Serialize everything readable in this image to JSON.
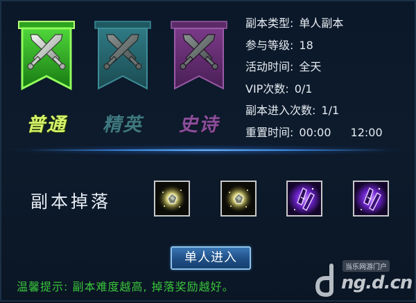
{
  "tiers": [
    {
      "label": "普通",
      "icon": "crossed-swords-icon",
      "color": "#2fae1e",
      "selected": true
    },
    {
      "label": "精英",
      "icon": "crossed-swords-icon",
      "color": "#2e6f79",
      "selected": false
    },
    {
      "label": "史诗",
      "icon": "crossed-swords-icon",
      "color": "#7d3a8c",
      "selected": false
    }
  ],
  "info": {
    "type_label": "副本类型:",
    "type_value": "单人副本",
    "level_label": "参与等级:",
    "level_value": "18",
    "time_label": "活动时间:",
    "time_value": "全天",
    "vip_label": "VIP次数:",
    "vip_value": "0/1",
    "entries_label": "副本进入次数:",
    "entries_value": "1/1",
    "reset_label": "重置时间:",
    "reset_value_1": "00:00",
    "reset_value_2": "12:00"
  },
  "drops": {
    "title": "副本掉落",
    "items": [
      {
        "icon": "glowing-gem-icon",
        "color": "#d8d27a"
      },
      {
        "icon": "glowing-gem-icon",
        "color": "#d8d27a"
      },
      {
        "icon": "purple-crystal-icon",
        "color": "#9a4cff"
      },
      {
        "icon": "purple-crystal-icon",
        "color": "#9a4cff"
      }
    ]
  },
  "enter_button": "单人进入",
  "tip": "温馨提示: 副本难度越高, 掉落奖励越好。",
  "watermark": {
    "small": "当乐网游门户",
    "main": "ng.d.cn"
  }
}
